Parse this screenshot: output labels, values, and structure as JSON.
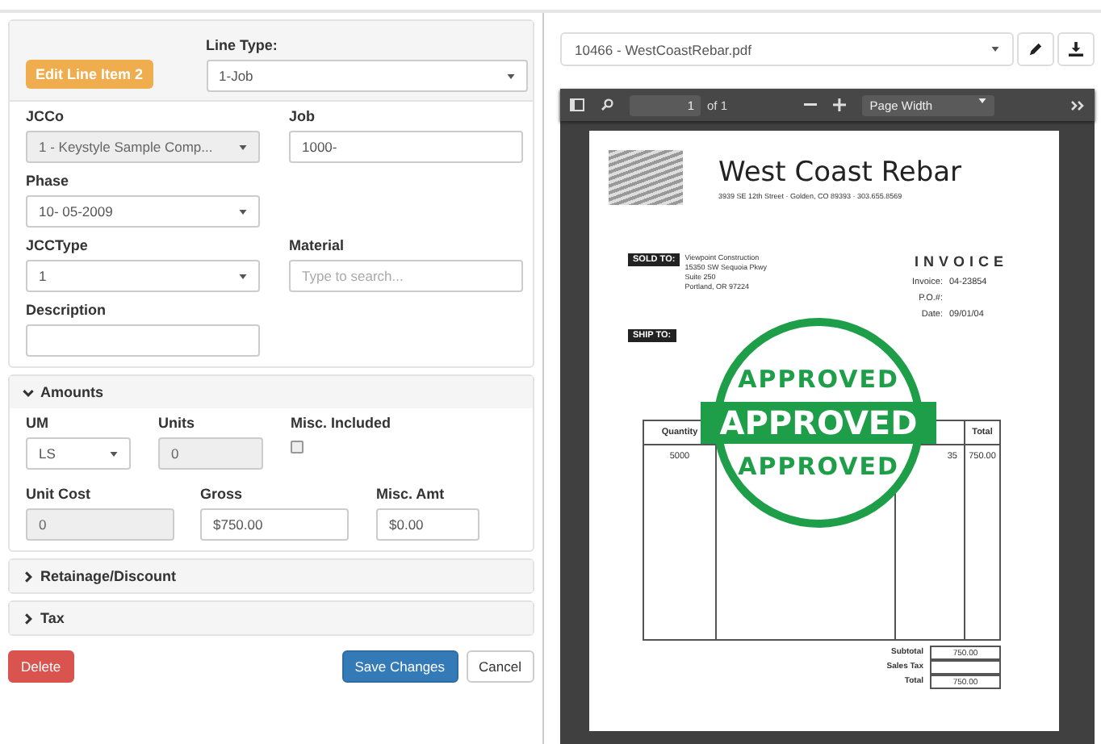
{
  "editor": {
    "badge": "Edit Line Item 2",
    "line_type": {
      "label": "Line Type:",
      "value": "1-Job"
    },
    "rows": [
      {
        "fields": [
          {
            "kind": "select",
            "label": "JCCo",
            "value": "1 - Keystyle Sample Comp...",
            "disabled": true
          },
          {
            "kind": "input",
            "label": "Job",
            "value": "1000-",
            "disabled": false
          }
        ]
      },
      {
        "fields": [
          {
            "kind": "select",
            "label": "Phase",
            "value": "10- 05-2009",
            "disabled": false
          }
        ]
      },
      {
        "fields": [
          {
            "kind": "select",
            "label": "JCCType",
            "value": "1",
            "disabled": false
          },
          {
            "kind": "input",
            "label": "Material",
            "placeholder": "Type to search...",
            "disabled": false
          }
        ]
      },
      {
        "fields": [
          {
            "kind": "input",
            "label": "Description",
            "disabled": false
          }
        ]
      }
    ],
    "sections": [
      {
        "title": "Amounts",
        "expanded": true,
        "rows": [
          {
            "fields": [
              {
                "kind": "select",
                "label": "UM",
                "value": "LS",
                "disabled": false
              },
              {
                "kind": "input",
                "label": "Units",
                "value": "0",
                "disabled": true
              },
              {
                "kind": "checkbox",
                "label": "Misc. Included",
                "checked": false
              }
            ]
          },
          {
            "fields": [
              {
                "kind": "input",
                "label": "Unit Cost",
                "value": "0",
                "disabled": true
              },
              {
                "kind": "input",
                "label": "Gross",
                "value": "$750.00",
                "disabled": false
              },
              {
                "kind": "input",
                "label": "Misc. Amt",
                "value": "$0.00",
                "disabled": false
              }
            ]
          }
        ]
      },
      {
        "title": "Retainage/Discount",
        "expanded": false
      },
      {
        "title": "Tax",
        "expanded": false
      }
    ],
    "buttons": {
      "delete": "Delete",
      "save": "Save Changes",
      "cancel": "Cancel"
    }
  },
  "viewer": {
    "file": "10466 - WestCoastRebar.pdf",
    "page": "1",
    "page_count": "of 1",
    "zoom": "Page Width",
    "invoice": {
      "company": "West Coast Rebar",
      "address": "3939 SE 12th Street · Golden, CO 89393 · 303.655.8569",
      "sold_to_label": "SOLD TO:",
      "sold_to": [
        "Viewpoint Construction",
        "15350 SW Sequoia Pkwy",
        "Suite 250",
        "Portland, OR 97224"
      ],
      "ship_to_label": "SHIP TO:",
      "title": "INVOICE",
      "info": [
        {
          "label": "Invoice:",
          "value": "04-23854"
        },
        {
          "label": "P.O.#:"
        },
        {
          "label": "Date:",
          "value": "09/01/04"
        }
      ],
      "columns": [
        "Quantity",
        "Total"
      ],
      "row": {
        "quantity": "5000",
        "price": "35",
        "total": "750.00"
      },
      "totals": [
        {
          "label": "Subtotal",
          "value": "750.00"
        },
        {
          "label": "Sales Tax"
        },
        {
          "label": "Total",
          "value": "750.00"
        }
      ],
      "stamp": {
        "top": "APPROVED",
        "banner": "APPROVED",
        "bottom": "APPROVED"
      }
    }
  }
}
